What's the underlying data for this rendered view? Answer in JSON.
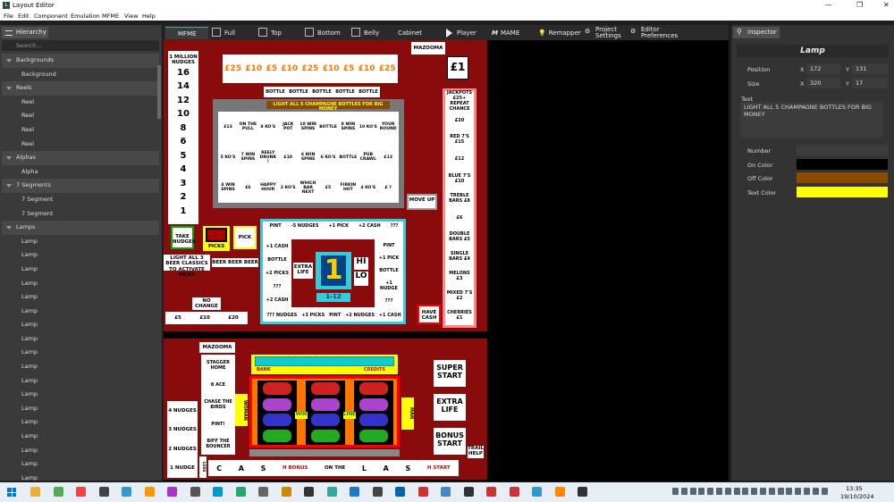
{
  "window": {
    "title": "Layout Editor",
    "min": "—",
    "max": "❐",
    "close": "✕"
  },
  "menu": [
    "File",
    "Edit",
    "Component",
    "Emulation",
    "MFME",
    "View",
    "Help"
  ],
  "hierarchy": {
    "title": "Hierarchy",
    "search_placeholder": "Search...",
    "rows": [
      {
        "t": "grp",
        "label": "Backgrounds"
      },
      {
        "t": "item",
        "label": "Background"
      },
      {
        "t": "grp",
        "label": "Reels"
      },
      {
        "t": "item",
        "label": "Reel"
      },
      {
        "t": "item",
        "label": "Reel"
      },
      {
        "t": "item",
        "label": "Reel"
      },
      {
        "t": "item",
        "label": "Reel"
      },
      {
        "t": "grp",
        "label": "Alphas"
      },
      {
        "t": "item",
        "label": "Alpha"
      },
      {
        "t": "grp",
        "label": "7 Segments"
      },
      {
        "t": "item",
        "label": "7 Segment"
      },
      {
        "t": "item",
        "label": "7 Segment"
      },
      {
        "t": "grp",
        "label": "Lamps"
      },
      {
        "t": "item",
        "label": "Lamp"
      },
      {
        "t": "item",
        "label": "Lamp"
      },
      {
        "t": "item",
        "label": "Lamp"
      },
      {
        "t": "item",
        "label": "Lamp"
      },
      {
        "t": "item",
        "label": "Lamp"
      },
      {
        "t": "item",
        "label": "Lamp"
      },
      {
        "t": "item",
        "label": "Lamp"
      },
      {
        "t": "item",
        "label": "Lamp"
      },
      {
        "t": "item",
        "label": "Lamp"
      },
      {
        "t": "item",
        "label": "Lamp"
      },
      {
        "t": "item",
        "label": "Lamp"
      },
      {
        "t": "item",
        "label": "Lamp"
      },
      {
        "t": "item",
        "label": "Lamp"
      },
      {
        "t": "item",
        "label": "Lamp"
      },
      {
        "t": "item",
        "label": "Lamp"
      },
      {
        "t": "item",
        "label": "Lamp"
      },
      {
        "t": "item",
        "label": "Lamp"
      },
      {
        "t": "item",
        "label": "Lamp"
      }
    ]
  },
  "toolbar": {
    "mfme": "MFME",
    "full": "Full",
    "top": "Top",
    "bottom": "Bottom",
    "belly": "Belly",
    "cabinet": "Cabinet",
    "player": "Player",
    "mame": "MAME",
    "remapper": "Remapper",
    "project_settings": "Project Settings",
    "editor_preferences": "Editor Preferences"
  },
  "inspector": {
    "title": "Inspector",
    "component": "Lamp",
    "position_label": "Position",
    "x_label": "X",
    "y_label": "Y",
    "x": "172",
    "y": "131",
    "size_label": "Size",
    "w": "320",
    "h": "17",
    "text_label": "Text",
    "text": "LIGHT ALL 5 CHAMPAGNE BOTTLES FOR BIG MONEY",
    "number_label": "Number",
    "on_color_label": "On Color",
    "off_color_label": "Off Color",
    "text_color_label": "Text Color",
    "colors": {
      "number": "#3c3c3c",
      "on": "#000000",
      "off": "#8a4a00",
      "text": "#ffff00"
    }
  },
  "layout": {
    "mazooma_top": "MAZOOMA",
    "pound1": "£1",
    "nudges_title": "1 MILLION NUDGES",
    "nudges": [
      "16",
      "14",
      "12",
      "10",
      "8",
      "6",
      "5",
      "4",
      "3",
      "2",
      "1"
    ],
    "money_strip": [
      "£25",
      "£10",
      "£5",
      "£10",
      "£25",
      "£10",
      "£5",
      "£10",
      "£25"
    ],
    "bottle_row": [
      "BOTTLE",
      "BOTTLE",
      "BOTTLE",
      "BOTTLE",
      "BOTTLE"
    ],
    "banner": "LIGHT ALL 5 CHAMPAGNE BOTTLES FOR BIG MONEY",
    "grid": [
      [
        "£13",
        "ON THE PULL",
        "8 KO'S",
        "JACK POT",
        "10 WIN SPINS",
        "BOTTLE",
        "8 WIN SPINS",
        "10 KO'S",
        "YOUR ROUND"
      ],
      [
        "5 KO'S",
        "7 WIN SPINS",
        "REELY DRUNK !",
        "£10",
        "6 WIN SPINS",
        "6 KO'S",
        "BOTTLE",
        "PUB CRAWL",
        "£13"
      ],
      [
        "4 WIN SPINS",
        "£6",
        "HAPPY HOUR",
        "3 KO'S",
        "WHICH BAR NEXT",
        "£5",
        "FIRKIN HOT",
        "4 KO'S",
        "£ ?"
      ]
    ],
    "move_up": "MOVE UP",
    "jackpots": [
      "JACKPOTS £25+ REPEAT CHANCE",
      "£20",
      "RED 7'S £15",
      "£12",
      "BLUE 7'S £10",
      "TREBLE BARS £8",
      "£6",
      "DOUBLE BARS £5",
      "SINGLE BARS £4",
      "MELONS £3",
      "MIXED 7'S £2",
      "CHERRIES £1"
    ],
    "have_cash": "HAVE CASH",
    "take_nudges": "TAKE NUDGES",
    "picks": "PICKS",
    "pick": "PICK",
    "beer_note": "LIGHT ALL 3 BEER CLASSICS TO ACTIVATE PICKS",
    "beer_row": "BEER BEER BEER",
    "no_change": "NO CHANGE",
    "cash_row": [
      "£5",
      "£10",
      "£20"
    ],
    "pick_top": [
      "PINT",
      "-5 NUDGES",
      "+1 PICK",
      "+2 CASH",
      "???"
    ],
    "pick_left": [
      "+1 CASH",
      "BOTTLE",
      "+2 PICKS",
      "???",
      "+2 CASH"
    ],
    "pick_right": [
      "PINT",
      "+1 PICK",
      "BOTTLE",
      "+1 NUDGE",
      "???"
    ],
    "pick_bottom": [
      "??? NUDGES",
      "+3 PICKS",
      "PINT",
      "+2 NUDGES",
      "+1 CASH"
    ],
    "extra_life": "EXTRA LIFE",
    "hi": "HI",
    "lo": "LO",
    "digit": "1",
    "range": "1-12",
    "mazooma_bottom": "MAZOOMA",
    "features": [
      "STAGGER HOME",
      "8 ACE",
      "CHASE THE BIRDS",
      "PINT!",
      "BIFF THE BOUNCER"
    ],
    "nudge_stack": [
      "4 NUDGES",
      "3 NUDGES",
      "2 NUDGES",
      "1 NUDGE"
    ],
    "woman": "WOMAN",
    "man": "MAN",
    "bank": "BANK",
    "credits": "CREDITS",
    "win": "WIN",
    "line": "LINE",
    "super_start": "SUPER START",
    "extra_life_btn": "EXTRA LIFE",
    "bonus_start": "BONUS START",
    "trail_help": "TRAIL HELP",
    "loss": "LOSS",
    "cash_trail": [
      "C",
      "A",
      "S",
      "H BONUS",
      "ON THE",
      "L",
      "A",
      "S",
      "H START"
    ]
  },
  "taskbar": {
    "time": "13:35",
    "date": "19/10/2024"
  }
}
